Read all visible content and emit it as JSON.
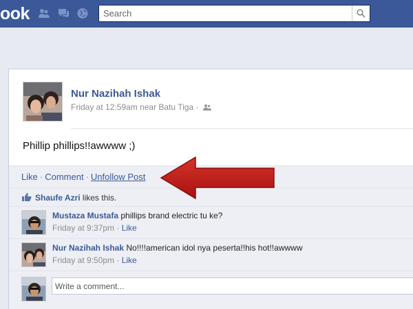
{
  "topbar": {
    "logo_text": "ook",
    "jewels": [
      "friend-requests-icon",
      "messages-icon",
      "notifications-globe-icon"
    ],
    "search": {
      "placeholder": "Search",
      "button_icon": "magnifier-icon"
    }
  },
  "story": {
    "author": "Nur Nazihah Ishak",
    "meta": "Friday at 12:59am near Batu Tiga ·",
    "privacy_icon": "friends-audience-icon",
    "message": "Phillip phillips!!awwww ;)",
    "actions": {
      "like": "Like",
      "sep": "·",
      "comment": "Comment",
      "unfollow": "Unfollow Post"
    },
    "likes": {
      "name": "Shaufe Azri",
      "text": " likes this."
    },
    "comments": [
      {
        "author": "Mustaza Mustafa",
        "text": " phillips brand electric tu ke?",
        "time": "Friday at 9:37pm · ",
        "like": "Like"
      },
      {
        "author": "Nur Nazihah Ishak",
        "text": " No!!!!american idol nya peserta!!his hot!!awwww",
        "time": "Friday at 9:50pm · ",
        "like": "Like"
      }
    ],
    "write_comment_placeholder": "Write a comment..."
  },
  "colors": {
    "brand_blue": "#3b5998",
    "annotation_arrow": "#c0201e"
  }
}
